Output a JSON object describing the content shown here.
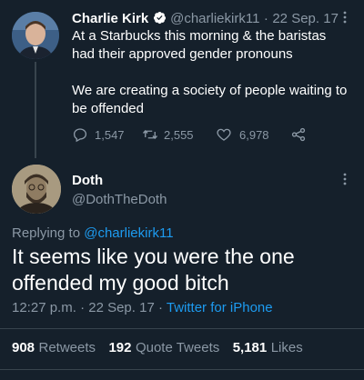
{
  "parent_tweet": {
    "author_name": "Charlie Kirk",
    "handle": "@charliekirk11",
    "separator": "·",
    "date": "22 Sep. 17",
    "text_line1": "At a Starbucks this morning & the baristas",
    "text_line2": "had their approved gender pronouns",
    "text_line3": "We are creating a society of people waiting to",
    "text_line4": "be offended",
    "replies": "1,547",
    "retweets": "2,555",
    "likes": "6,978"
  },
  "main_tweet": {
    "author_name": "Doth",
    "handle": "@DothTheDoth",
    "replying_prefix": "Replying to",
    "replying_to": "@charliekirk11",
    "text_line1": "It seems like you were the one",
    "text_line2": "offended my good bitch",
    "time": "12:27 p.m.",
    "sep1": "·",
    "date": "22 Sep. 17",
    "sep2": "·",
    "source": "Twitter for iPhone"
  },
  "stats": {
    "retweets_count": "908",
    "retweets_label": "Retweets",
    "quotes_count": "192",
    "quotes_label": "Quote Tweets",
    "likes_count": "5,181",
    "likes_label": "Likes"
  },
  "colors": {
    "background": "#15202b",
    "accent": "#1d9bf0",
    "muted": "#8b98a5",
    "divider": "#38444d"
  }
}
